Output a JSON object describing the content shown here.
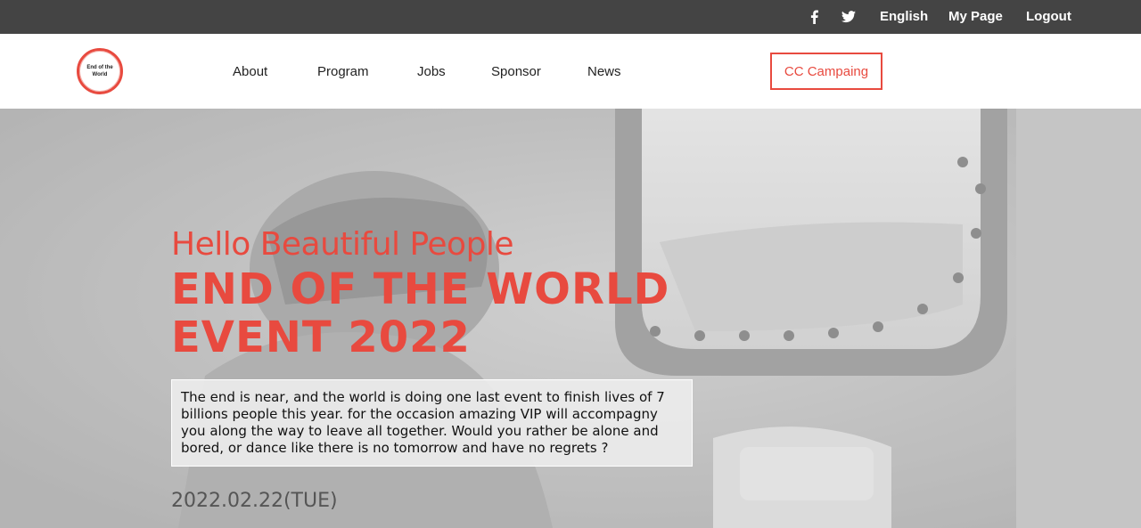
{
  "topbar": {
    "facebook_icon": "facebook-icon",
    "twitter_icon": "twitter-icon",
    "language": "English",
    "my_page": "My Page",
    "logout": "Logout"
  },
  "logo": {
    "line1": "End of the",
    "line2": "World"
  },
  "nav": {
    "items": [
      "About",
      "Program",
      "Jobs",
      "Sponsor",
      "News"
    ],
    "cta": "CC Campaing"
  },
  "hero": {
    "greeting": "Hello Beautiful People",
    "title_line1": "END OF THE WORLD",
    "title_line2": "EVENT 2022",
    "description": "The end is near, and the world is doing one last event to finish lives of 7 billions people this year. for the occasion amazing VIP will accompagny you along the way to leave all together. Would you rather be alone and bored, or dance like there is no tomorrow and have no regrets ?",
    "date": "2022.02.22(TUE)"
  },
  "colors": {
    "accent": "#e84a3f",
    "topbar": "#444444"
  }
}
